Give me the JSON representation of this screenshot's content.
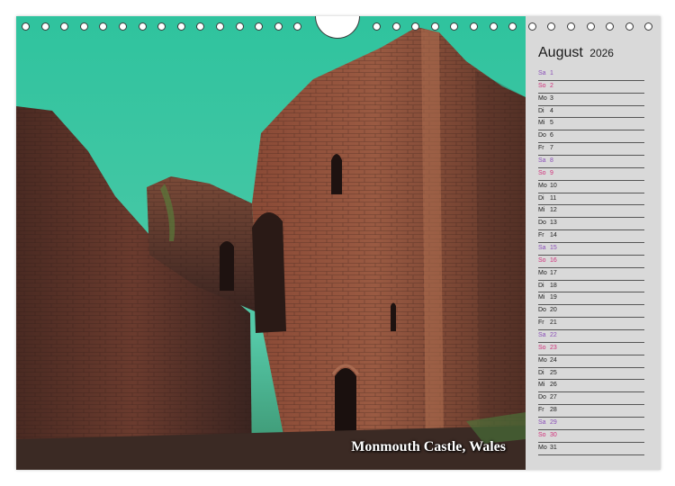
{
  "calendar": {
    "month": "August",
    "year": "2026",
    "days": [
      {
        "wd": "Sa",
        "n": "1",
        "type": "sa"
      },
      {
        "wd": "So",
        "n": "2",
        "type": "so"
      },
      {
        "wd": "Mo",
        "n": "3",
        "type": ""
      },
      {
        "wd": "Di",
        "n": "4",
        "type": ""
      },
      {
        "wd": "Mi",
        "n": "5",
        "type": ""
      },
      {
        "wd": "Do",
        "n": "6",
        "type": ""
      },
      {
        "wd": "Fr",
        "n": "7",
        "type": ""
      },
      {
        "wd": "Sa",
        "n": "8",
        "type": "sa"
      },
      {
        "wd": "So",
        "n": "9",
        "type": "so"
      },
      {
        "wd": "Mo",
        "n": "10",
        "type": ""
      },
      {
        "wd": "Di",
        "n": "11",
        "type": ""
      },
      {
        "wd": "Mi",
        "n": "12",
        "type": ""
      },
      {
        "wd": "Do",
        "n": "13",
        "type": ""
      },
      {
        "wd": "Fr",
        "n": "14",
        "type": ""
      },
      {
        "wd": "Sa",
        "n": "15",
        "type": "sa"
      },
      {
        "wd": "So",
        "n": "16",
        "type": "so"
      },
      {
        "wd": "Mo",
        "n": "17",
        "type": ""
      },
      {
        "wd": "Di",
        "n": "18",
        "type": ""
      },
      {
        "wd": "Mi",
        "n": "19",
        "type": ""
      },
      {
        "wd": "Do",
        "n": "20",
        "type": ""
      },
      {
        "wd": "Fr",
        "n": "21",
        "type": ""
      },
      {
        "wd": "Sa",
        "n": "22",
        "type": "sa"
      },
      {
        "wd": "So",
        "n": "23",
        "type": "so"
      },
      {
        "wd": "Mo",
        "n": "24",
        "type": ""
      },
      {
        "wd": "Di",
        "n": "25",
        "type": ""
      },
      {
        "wd": "Mi",
        "n": "26",
        "type": ""
      },
      {
        "wd": "Do",
        "n": "27",
        "type": ""
      },
      {
        "wd": "Fr",
        "n": "28",
        "type": ""
      },
      {
        "wd": "Sa",
        "n": "29",
        "type": "sa"
      },
      {
        "wd": "So",
        "n": "30",
        "type": "so"
      },
      {
        "wd": "Mo",
        "n": "31",
        "type": ""
      }
    ]
  },
  "photo": {
    "caption": "Monmouth Castle, Wales"
  },
  "colors": {
    "sky": "#2fc39e",
    "saturday": "#8a4fb8",
    "sunday": "#d0307a",
    "panel": "#d9d9d9"
  }
}
